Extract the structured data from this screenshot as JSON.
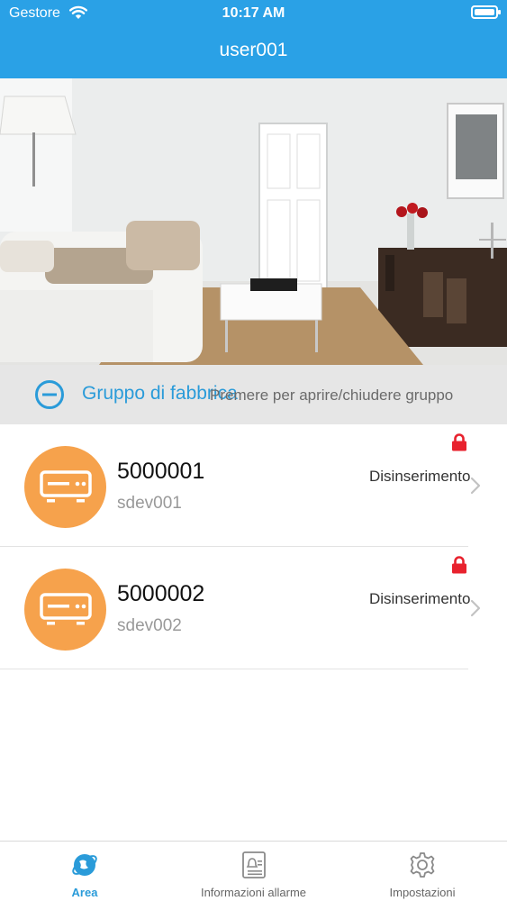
{
  "status_bar": {
    "carrier": "Gestore",
    "time": "10:17 AM"
  },
  "header": {
    "title": "user001"
  },
  "hero": {
    "description": "living-room-photo"
  },
  "group": {
    "name": "Gruppo di fabbrica",
    "hint": "Premere per aprire/chiudere gruppo"
  },
  "devices": [
    {
      "name": "5000001",
      "subtitle": "sdev001",
      "status": "Disinserimento"
    },
    {
      "name": "5000002",
      "subtitle": "sdev002",
      "status": "Disinserimento"
    }
  ],
  "tabs": [
    {
      "label": "Area",
      "icon": "globe-icon",
      "active": true
    },
    {
      "label": "Informazioni allarme",
      "icon": "alarm-info-icon",
      "active": false
    },
    {
      "label": "Impostazioni",
      "icon": "gear-icon",
      "active": false
    }
  ],
  "colors": {
    "accent": "#2aa1e6",
    "device_avatar": "#f6a24c",
    "lock": "#e8222e"
  }
}
